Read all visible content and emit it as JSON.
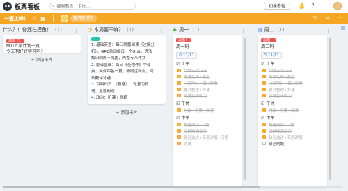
{
  "app": {
    "title": "板栗看板",
    "search_placeholder": "搜索看板、卡片...",
    "switch_label": "切换看板"
  },
  "board": {
    "name": "一壹上岸！",
    "invite_label": "邀请新成员"
  },
  "colors": {
    "accent": "#f5a623",
    "red_tag": "#ef5350",
    "teal_tag": "#26c6b0",
    "blue_text": "#3a7bd5"
  },
  "icons": {
    "top": [
      "bell-icon",
      "help-icon",
      "user-avatar"
    ],
    "board": [
      "star-icon",
      "calendar-icon",
      "filter-icon",
      "share-icon",
      "more-icon"
    ]
  },
  "columns": [
    {
      "title": "什么？！你还在摸鱼！",
      "count": "(1)",
      "card": {
        "tag": "激励卡！",
        "lines": [
          "MTI上岸计划一览",
          "今天有好好学习吗?"
        ]
      },
      "add_label": "+ 添加卡片"
    },
    {
      "title": "本周要干嘛？",
      "count": "(1)",
      "card": {
        "lines": [
          "1. 基础英语：每日两篇阅读（注解分",
          "析），GRE单词每日一个Unit，语法",
          "知识回顾＋巩固，再整专八作文",
          "2. 翻译基础：每日《莅啥作》中译",
          "英、英译中各一篇，随时注释点，词",
          "条翻译背诵",
          "3. 百科知识：《要略》二轮复习背",
          "诵，重题刷题",
          "4. 政治：听课＋刷题"
        ]
      },
      "add_label": "+ 添加卡片"
    },
    {
      "title": "周一",
      "count": "(1)",
      "card": {
        "tag": "逗猫！",
        "name": "周一码",
        "date": "11/11",
        "sections": [
          {
            "title": "上午",
            "items": [
              "GRE一个unit",
              "无惑注释+复盘",
              "《莅啥》一篇+复盘",
              "要义整理+背诵",
              "背诵打卡练习"
            ]
          },
          {
            "title": "午休",
            "items": [
              "时政+干货一阅读"
            ]
          },
          {
            "title": "下午",
            "items": [
              "英语阅读1-2篇",
              "汉翻短语复习",
              "政治选讲+专题讲解+习题",
              "背诵"
            ]
          }
        ]
      }
    },
    {
      "title": "周二",
      "count": "(1)",
      "card": {
        "tag": "逗猫！",
        "name": "周二码",
        "date": "11/11",
        "sections": [
          {
            "title": "上午",
            "items": [
              "GRE一个unit",
              "无惑注释+复盘",
              "《莅啥》一篇+复盘",
              "要义整理+背诵",
              "背诵打卡练习"
            ]
          },
          {
            "title": "午休",
            "items": [
              "时政+干货一阅读"
            ]
          },
          {
            "title": "下午",
            "items": [
              "英语阅读1-2篇",
              "汉翻短语复习",
              "政治选讲+专题讲解",
              "政治刷题"
            ]
          }
        ]
      }
    }
  ]
}
